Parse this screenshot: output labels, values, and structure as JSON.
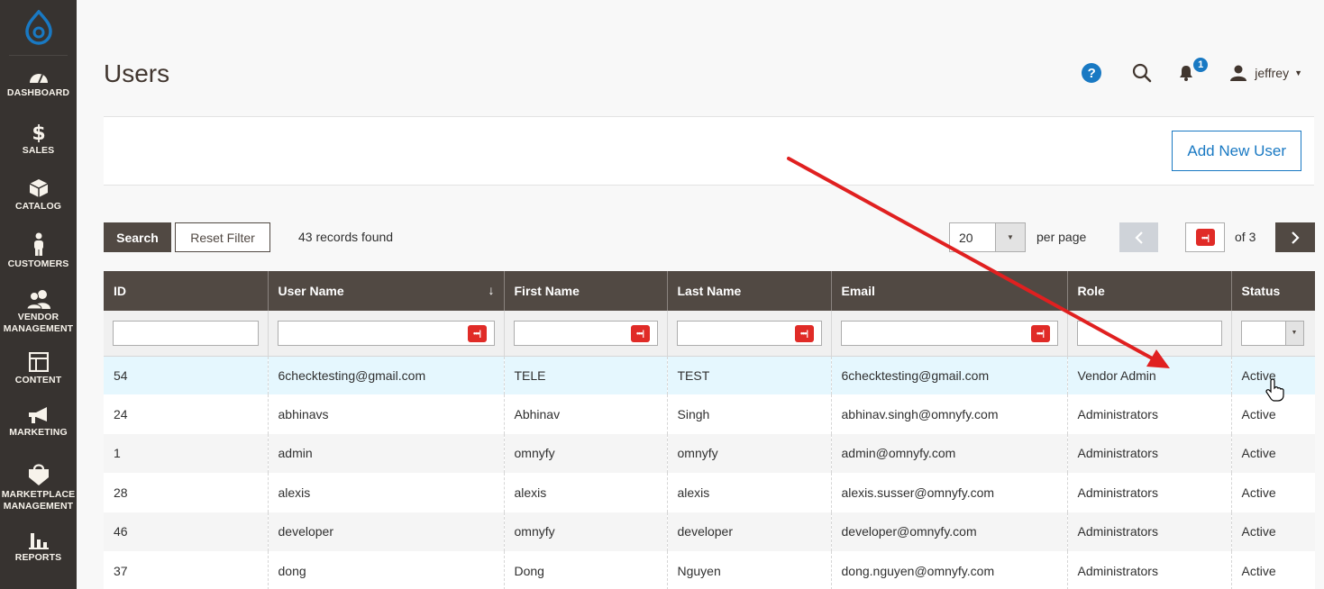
{
  "sidebar": {
    "items": [
      {
        "key": "dashboard",
        "label": "DASHBOARD",
        "icon": "speedometer-icon"
      },
      {
        "key": "sales",
        "label": "SALES",
        "icon": "dollar-icon"
      },
      {
        "key": "catalog",
        "label": "CATALOG",
        "icon": "box-icon"
      },
      {
        "key": "customers",
        "label": "CUSTOMERS",
        "icon": "person-icon"
      },
      {
        "key": "vendor",
        "label": "VENDOR\nMANAGEMENT",
        "icon": "people-icon"
      },
      {
        "key": "content",
        "label": "CONTENT",
        "icon": "layout-icon"
      },
      {
        "key": "marketing",
        "label": "MARKETING",
        "icon": "megaphone-icon"
      },
      {
        "key": "marketplace",
        "label": "MARKETPLACE\nMANAGEMENT",
        "icon": "shopping-bag-icon"
      },
      {
        "key": "reports",
        "label": "REPORTS",
        "icon": "bar-chart-icon"
      }
    ]
  },
  "header": {
    "title": "Users",
    "help": "?",
    "notification_count": "1",
    "username": "jeffrey"
  },
  "actions": {
    "add_new_user": "Add New User"
  },
  "toolbar": {
    "search": "Search",
    "reset_filter": "Reset Filter",
    "records_found": "43 records found",
    "per_page_value": "20",
    "per_page_label": "per page",
    "of_pages": "of 3"
  },
  "grid": {
    "columns": [
      "ID",
      "User Name",
      "First Name",
      "Last Name",
      "Email",
      "Role",
      "Status"
    ],
    "rows": [
      [
        "54",
        "6checktesting@gmail.com",
        "TELE",
        "TEST",
        "6checktesting@gmail.com",
        "Vendor Admin",
        "Active"
      ],
      [
        "24",
        "abhinavs",
        "Abhinav",
        "Singh",
        "abhinav.singh@omnyfy.com",
        "Administrators",
        "Active"
      ],
      [
        "1",
        "admin",
        "omnyfy",
        "omnyfy",
        "admin@omnyfy.com",
        "Administrators",
        "Active"
      ],
      [
        "28",
        "alexis",
        "alexis",
        "alexis",
        "alexis.susser@omnyfy.com",
        "Administrators",
        "Active"
      ],
      [
        "46",
        "developer",
        "omnyfy",
        "developer",
        "developer@omnyfy.com",
        "Administrators",
        "Active"
      ],
      [
        "37",
        "dong",
        "Dong",
        "Nguyen",
        "dong.nguyen@omnyfy.com",
        "Administrators",
        "Active"
      ]
    ]
  },
  "colors": {
    "sidebar_bg": "#373330",
    "header_row_bg": "#514943",
    "accent": "#1979c3",
    "annotation_arrow": "#e02020",
    "hover_row": "#e5f7fe"
  }
}
